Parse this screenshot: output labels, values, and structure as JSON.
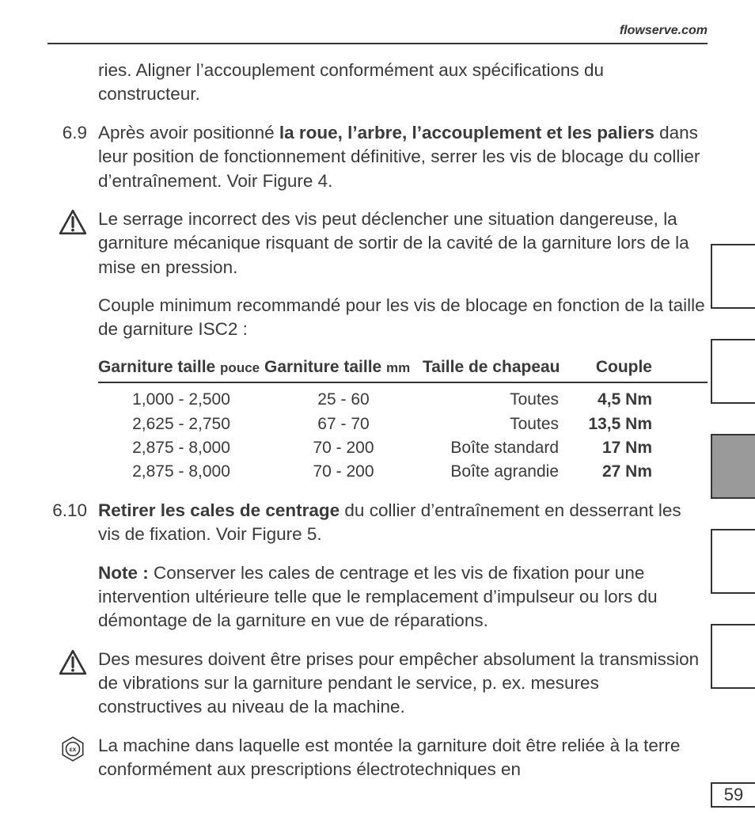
{
  "header": {
    "site": "flowserve.com"
  },
  "para_cont": "ries. Aligner l’accouplement conformément aux spécifications du constructeur.",
  "sec69": {
    "num": "6.9",
    "lead": "Après avoir positionné ",
    "bold": "la roue, l’arbre, l’accouplement et les paliers",
    "tail": " dans leur position de fonctionnement définitive, serrer les vis de blocage du collier d’entraînement. Voir Figure 4."
  },
  "warn1": "Le serrage incorrect des vis peut déclencher une situation dangereuse, la garniture mécanique risquant de sortir de la cavité de la garniture lors de la mise en pression.",
  "couple_intro": "Couple minimum recommandé pour les vis de blocage en fonction de la taille de garniture ISC2 :",
  "table": {
    "h1a": "Garniture taille ",
    "h1b": "pouce",
    "h2a": "Garniture taille ",
    "h2b": "mm",
    "h3": "Taille de chapeau",
    "h4": "Couple",
    "rows": [
      {
        "c1": "1,000 - 2,500",
        "c2": "25 -  60",
        "c3": "Toutes",
        "c4": "4,5 Nm"
      },
      {
        "c1": "2,625 - 2,750",
        "c2": "67 -  70",
        "c3": "Toutes",
        "c4": "13,5 Nm"
      },
      {
        "c1": "2,875 - 8,000",
        "c2": "70 -  200",
        "c3": "Boîte standard",
        "c4": "17 Nm"
      },
      {
        "c1": "2,875 - 8,000",
        "c2": "70 -  200",
        "c3": "Boîte agrandie",
        "c4": "27 Nm"
      }
    ]
  },
  "sec610": {
    "num": "6.10",
    "bold": "Retirer les cales de centrage",
    "tail": " du collier d’entraînement en desserrant les vis de fixation. Voir Figure 5."
  },
  "note": {
    "label": "Note :",
    "text": " Conserver les cales de centrage et les vis de fixation pour une intervention ultérieure telle que le remplacement d’impulseur ou lors du démontage de la garniture en vue de réparations."
  },
  "warn2": "Des mesures doivent être prises pour empêcher absolument la transmission de vibrations sur la garniture pendant le service, p. ex. mesures constructives au niveau de la machine.",
  "ex_text": "La machine dans laquelle est montée la garniture doit être reliée à la terre conformément aux prescriptions électrotechniques en",
  "page_number": "59"
}
